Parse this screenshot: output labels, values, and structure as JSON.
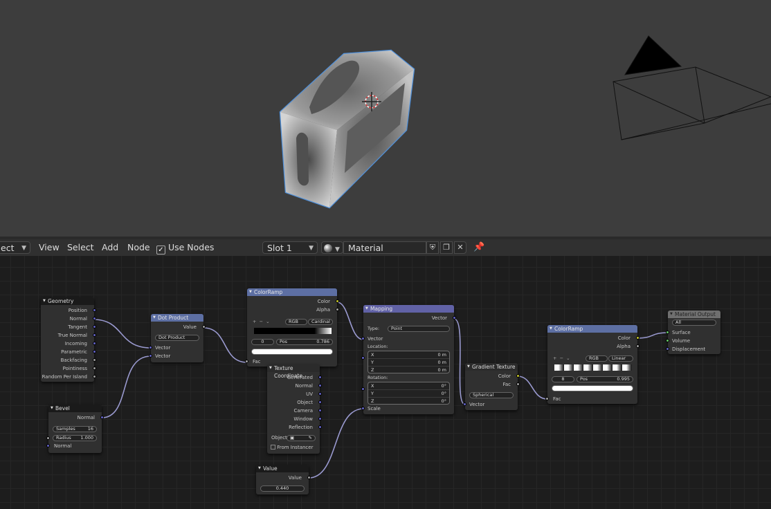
{
  "header": {
    "editor_type": "ect",
    "menus": [
      "View",
      "Select",
      "Add",
      "Node"
    ],
    "use_nodes": {
      "label": "Use Nodes",
      "checked": true
    },
    "slot": "Slot 1",
    "material": "Material"
  },
  "nodes": {
    "geometry": {
      "title": "Geometry",
      "outputs": [
        "Position",
        "Normal",
        "Tangent",
        "True Normal",
        "Incoming",
        "Parametric",
        "Backfacing",
        "Pointiness",
        "Random Per Island"
      ]
    },
    "bevel": {
      "title": "Bevel",
      "output": "Normal",
      "samples_label": "Samples",
      "samples": "16",
      "radius_label": "Radius",
      "radius": "1.000",
      "input_normal": "Normal"
    },
    "dot": {
      "title": "Dot Product",
      "output": "Value",
      "operation": "Dot Product",
      "inputs": [
        "Vector",
        "Vector"
      ]
    },
    "ramp1": {
      "title": "ColorRamp",
      "outputs": [
        "Color",
        "Alpha"
      ],
      "mode": "RGB",
      "interpolation": "Cardinal",
      "index": "0",
      "pos_label": "Pos",
      "pos": "0.786",
      "input": "Fac"
    },
    "texcoord": {
      "title": "Texture Coordinate",
      "outputs": [
        "Generated",
        "Normal",
        "UV",
        "Object",
        "Camera",
        "Window",
        "Reflection"
      ],
      "object_label": "Object",
      "from_instancer": "From Instancer"
    },
    "value": {
      "title": "Value",
      "output": "Value",
      "value": "0.440"
    },
    "mapping": {
      "title": "Mapping",
      "output": "Vector",
      "type_label": "Type:",
      "type": "Point",
      "input_vector": "Vector",
      "location_label": "Location:",
      "location": [
        {
          "axis": "X",
          "value": "0 m"
        },
        {
          "axis": "Y",
          "value": "0 m"
        },
        {
          "axis": "Z",
          "value": "0 m"
        }
      ],
      "rotation_label": "Rotation:",
      "rotation": [
        {
          "axis": "X",
          "value": "0°"
        },
        {
          "axis": "Y",
          "value": "0°"
        },
        {
          "axis": "Z",
          "value": "0°"
        }
      ],
      "scale_label": "Scale"
    },
    "gradient": {
      "title": "Gradient Texture",
      "outputs": [
        "Color",
        "Fac"
      ],
      "type": "Spherical",
      "input": "Vector"
    },
    "ramp2": {
      "title": "ColorRamp",
      "outputs": [
        "Color",
        "Alpha"
      ],
      "mode": "RGB",
      "interpolation": "Linear",
      "index": "8",
      "pos_label": "Pos",
      "pos": "0.995",
      "input": "Fac"
    },
    "output": {
      "title": "Material Output",
      "target": "All",
      "inputs": [
        "Surface",
        "Volume",
        "Displacement"
      ]
    }
  },
  "colors": {
    "socket_vector": "#6363c7",
    "socket_color": "#c7c729",
    "socket_float": "#a1a1a1",
    "socket_shader": "#63c763",
    "link": "#9a9ad0",
    "selection_outline": "#4f8fd8"
  }
}
